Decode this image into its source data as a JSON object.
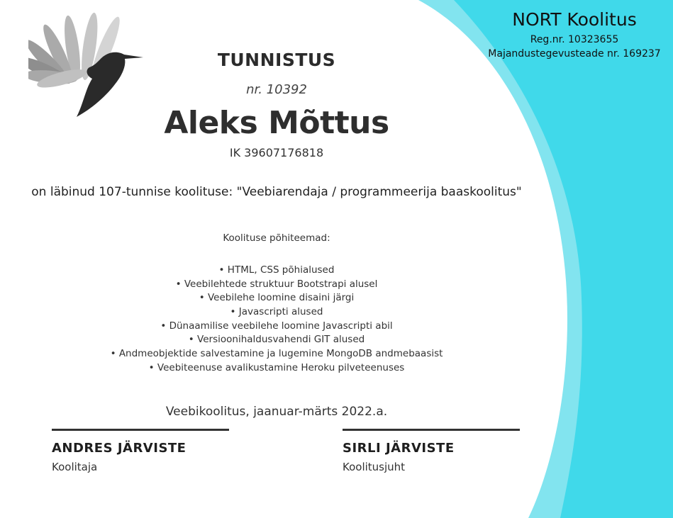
{
  "colors": {
    "accent_dark": "#40d9ea",
    "accent_light": "#82e4ef",
    "text": "#333333"
  },
  "logo": {
    "icon": "hummingbird-icon"
  },
  "organization": {
    "name": "NORT Koolitus",
    "reg_number": "Reg.nr. 10323655",
    "license": "Majandustegevusteade nr. 169237"
  },
  "certificate": {
    "title": "TUNNISTUS",
    "number": "nr. 10392",
    "recipient": "Aleks Mõttus",
    "id_code": "IK 39607176818",
    "statement": "on läbinud 107-tunnise koolituse: \"Veebiarendaja / programmeerija baaskoolitus\"",
    "topics_heading": "Koolituse põhiteemad:",
    "topics": [
      "• HTML, CSS põhialused",
      "• Veebilehtede struktuur Bootstrapi alusel",
      "• Veebilehe loomine disaini järgi",
      "• Javascripti alused",
      "• Dünaamilise veebilehe loomine Javascripti abil",
      "• Versioonihaldusvahendi GIT alused",
      "• Andmeobjektide salvestamine ja lugemine MongoDB andmebaasist",
      "• Veebiteenuse avalikustamine Heroku pilveteenuses"
    ],
    "period": "Veebikoolitus, jaanuar-märts 2022.a."
  },
  "signatures": [
    {
      "name": "ANDRES JÄRVISTE",
      "role": "Koolitaja"
    },
    {
      "name": "SIRLI JÄRVISTE",
      "role": "Koolitusjuht"
    }
  ]
}
